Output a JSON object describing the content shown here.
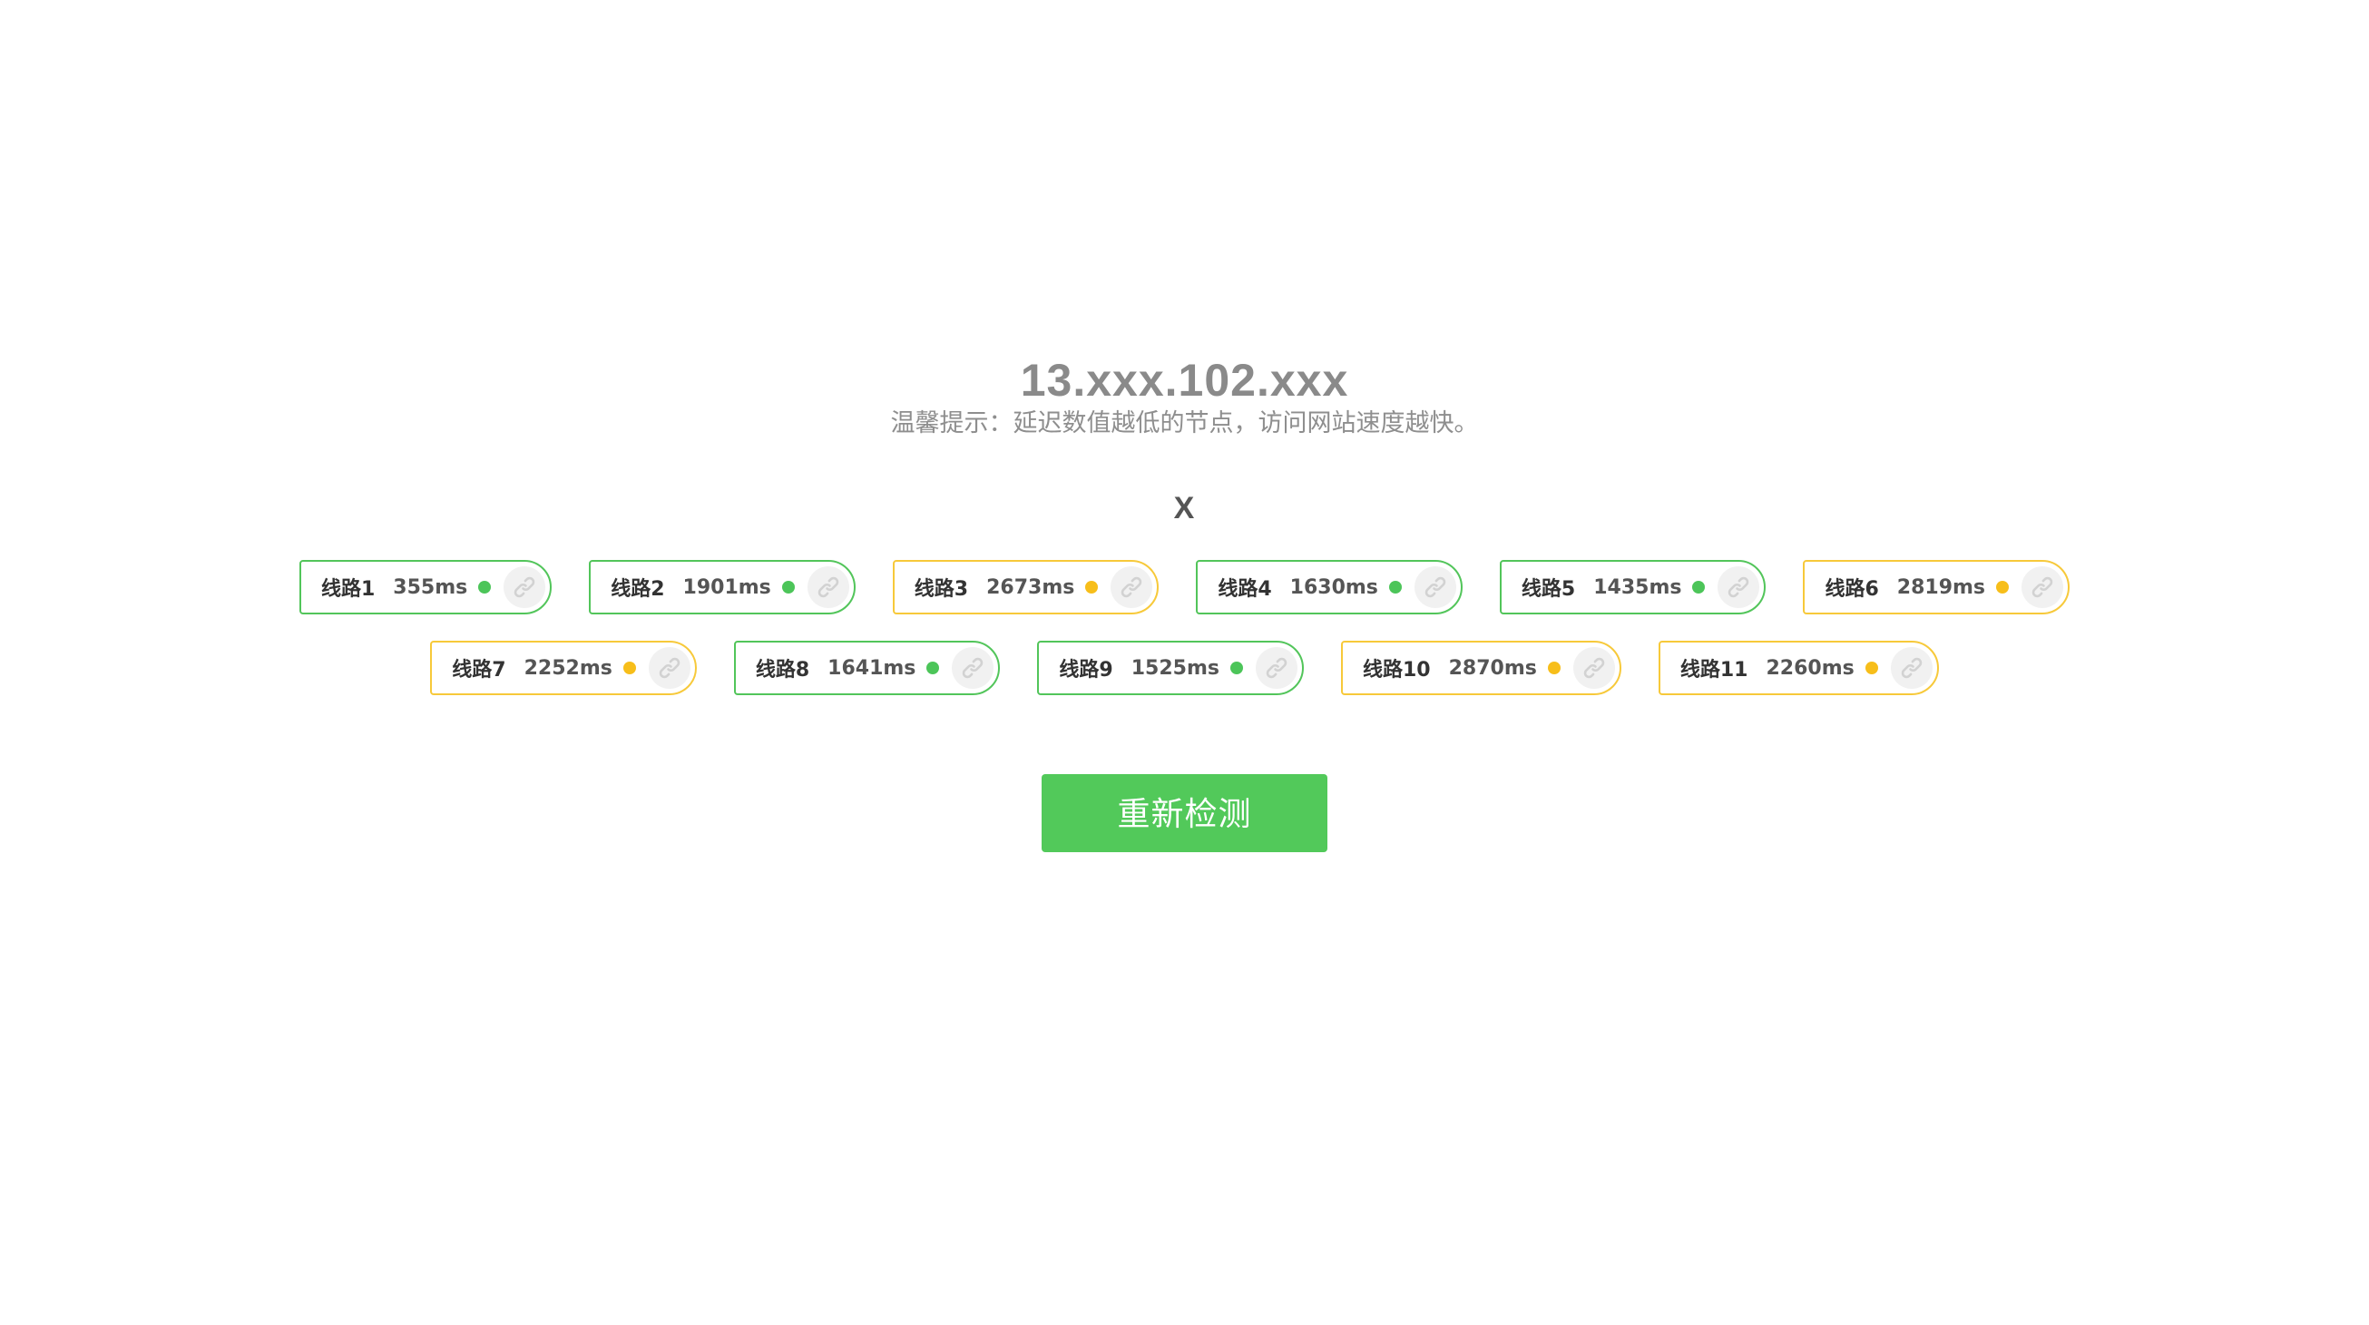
{
  "header": {
    "ip": "13.xxx.102.xxx",
    "tip": "温馨提示：延迟数值越低的节点，访问网站速度越快。"
  },
  "close_label": "X",
  "colors": {
    "good": "#52c55a",
    "warn": "#f7c93a",
    "button": "#52c95a"
  },
  "nodes": [
    {
      "name": "线路1",
      "latency": "355ms",
      "status": "good",
      "icon": "link-icon"
    },
    {
      "name": "线路2",
      "latency": "1901ms",
      "status": "good",
      "icon": "link-icon"
    },
    {
      "name": "线路3",
      "latency": "2673ms",
      "status": "warn",
      "icon": "link-icon"
    },
    {
      "name": "线路4",
      "latency": "1630ms",
      "status": "good",
      "icon": "link-icon"
    },
    {
      "name": "线路5",
      "latency": "1435ms",
      "status": "good",
      "icon": "link-icon"
    },
    {
      "name": "线路6",
      "latency": "2819ms",
      "status": "warn",
      "icon": "link-icon"
    },
    {
      "name": "线路7",
      "latency": "2252ms",
      "status": "warn",
      "icon": "link-icon"
    },
    {
      "name": "线路8",
      "latency": "1641ms",
      "status": "good",
      "icon": "link-icon"
    },
    {
      "name": "线路9",
      "latency": "1525ms",
      "status": "good",
      "icon": "link-icon"
    },
    {
      "name": "线路10",
      "latency": "2870ms",
      "status": "warn",
      "icon": "link-icon"
    },
    {
      "name": "线路11",
      "latency": "2260ms",
      "status": "warn",
      "icon": "link-icon"
    }
  ],
  "recheck_label": "重新检测"
}
